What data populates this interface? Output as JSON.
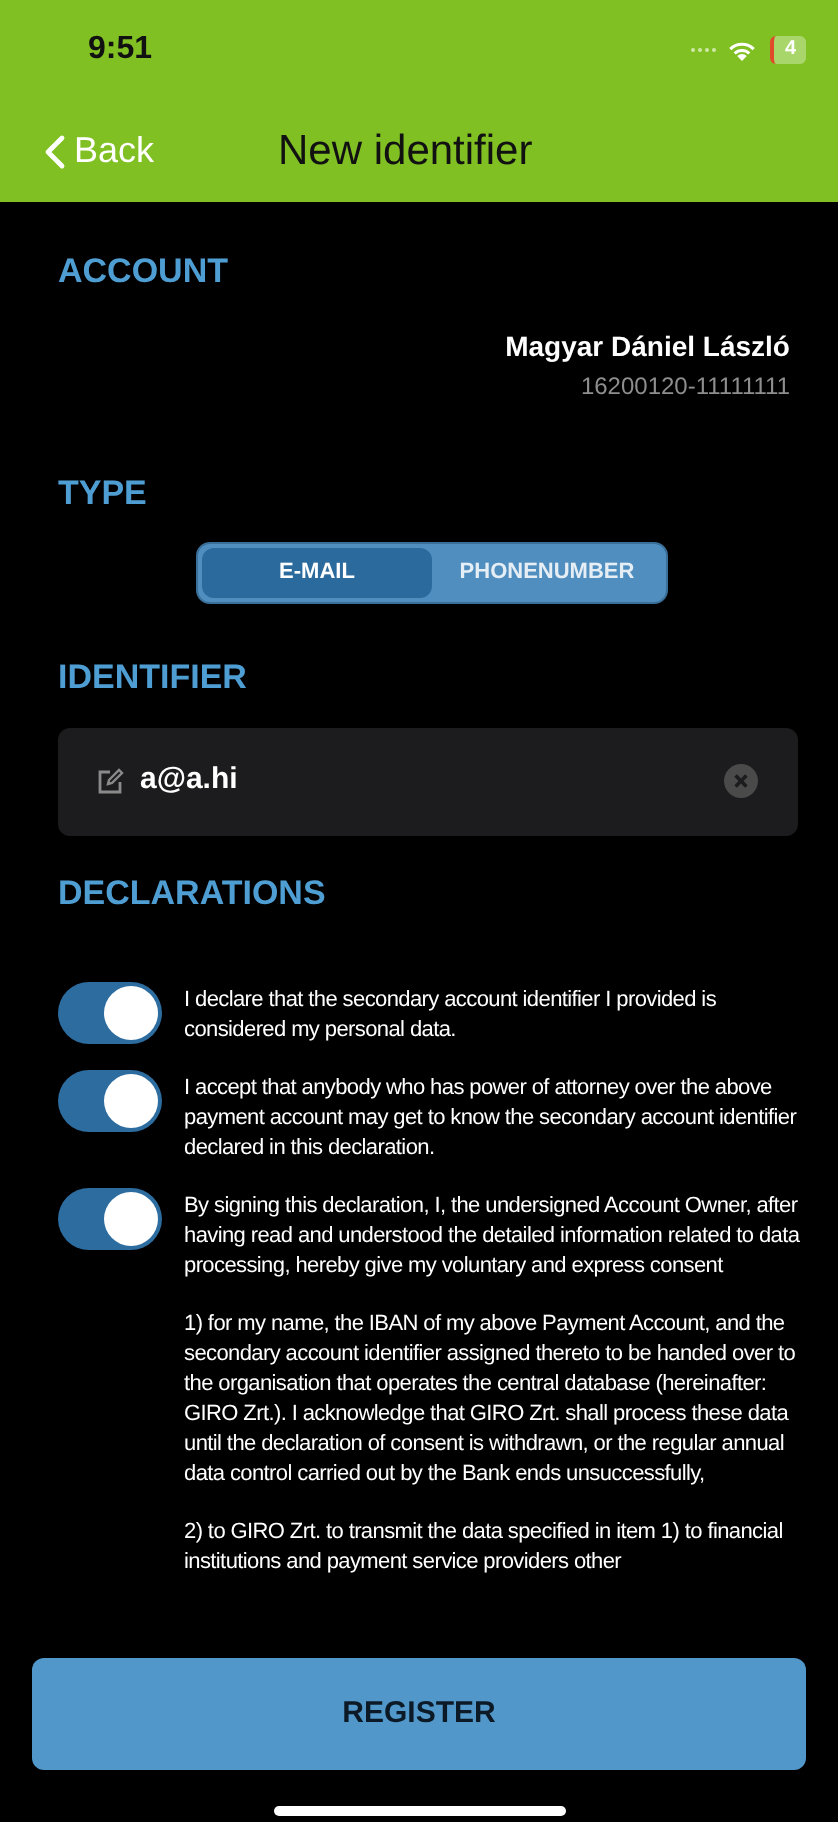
{
  "status_bar": {
    "time": "9:51",
    "battery": "4"
  },
  "nav": {
    "back": "Back",
    "title": "New identifier"
  },
  "account": {
    "heading": "ACCOUNT",
    "name": "Magyar Dániel László",
    "number": "16200120-11111111"
  },
  "type": {
    "heading": "TYPE",
    "options": [
      {
        "label": "E-MAIL",
        "selected": true
      },
      {
        "label": "PHONENUMBER",
        "selected": false
      }
    ]
  },
  "identifier": {
    "heading": "IDENTIFIER",
    "value": "a@a.hi"
  },
  "declarations": {
    "heading": "DECLARATIONS",
    "items": [
      {
        "on": true,
        "paragraphs": [
          "I declare that the secondary account identifier I provided is considered my personal data."
        ]
      },
      {
        "on": true,
        "paragraphs": [
          "I accept that anybody who has power of attorney over the above payment account may get to know the secondary account identifier declared in this declaration."
        ]
      },
      {
        "on": true,
        "paragraphs": [
          "By signing this declaration, I, the undersigned Account Owner, after having read and understood the detailed information related to data processing, hereby give my voluntary and express consent",
          "1) for my name, the IBAN of my above Payment Account, and the secondary account identifier assigned thereto to be handed over to the organisation that operates the central database (hereinafter: GIRO Zrt.). I acknowledge that GIRO Zrt. shall process these data until the declaration of consent is withdrawn, or the regular annual data control carried out by the Bank ends unsuccessfully,",
          "2) to GIRO Zrt. to transmit the data specified in item 1) to financial institutions and payment service providers other"
        ]
      }
    ]
  },
  "register_button": "REGISTER"
}
